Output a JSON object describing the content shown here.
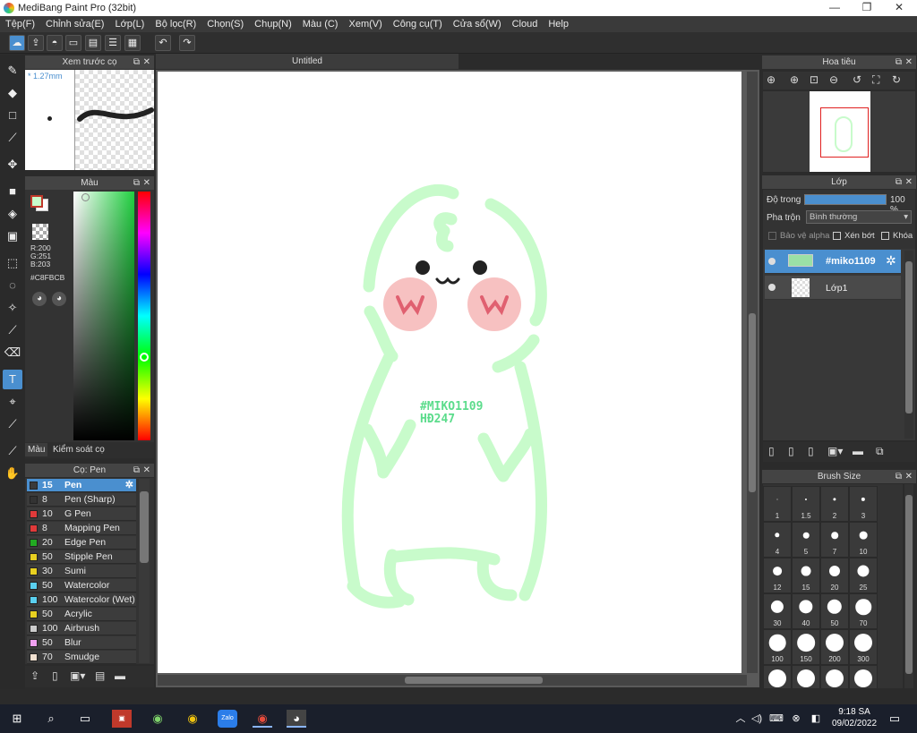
{
  "window": {
    "title": "MediBang Paint Pro (32bit)",
    "minimize": "—",
    "maximize": "❐",
    "close": "✕"
  },
  "menu": [
    "Tệp(F)",
    "Chỉnh sửa(E)",
    "Lớp(L)",
    "Bộ lọc(R)",
    "Chọn(S)",
    "Chụp(N)",
    "Màu (C)",
    "Xem(V)",
    "Công cụ(T)",
    "Cửa sổ(W)",
    "Cloud",
    "Help"
  ],
  "preview_panel": {
    "title": "Xem trước cọ",
    "size": "* 1.27mm"
  },
  "color_panel": {
    "title": "Màu",
    "r": "R:200",
    "g": "G:251",
    "b": "B:203",
    "hex": "#C8FBCB",
    "fg_color": "#C8FBCB",
    "tab_color": "Màu",
    "tab_brush_control": "Kiểm soát cọ"
  },
  "brush_panel": {
    "title": "Cọ: Pen",
    "items": [
      {
        "size": "15",
        "name": "Pen",
        "color": "#3a3a3a"
      },
      {
        "size": "8",
        "name": "Pen (Sharp)",
        "color": "#333333"
      },
      {
        "size": "10",
        "name": "G Pen",
        "color": "#e03a3a"
      },
      {
        "size": "8",
        "name": "Mapping Pen",
        "color": "#e03a3a"
      },
      {
        "size": "20",
        "name": "Edge Pen",
        "color": "#22aa22"
      },
      {
        "size": "50",
        "name": "Stipple Pen",
        "color": "#e8d020"
      },
      {
        "size": "30",
        "name": "Sumi",
        "color": "#e8d020"
      },
      {
        "size": "50",
        "name": "Watercolor",
        "color": "#5ad0f0"
      },
      {
        "size": "100",
        "name": "Watercolor (Wet)",
        "color": "#5ad0f0"
      },
      {
        "size": "50",
        "name": "Acrylic",
        "color": "#e8d020"
      },
      {
        "size": "100",
        "name": "Airbrush",
        "color": "#cccccc"
      },
      {
        "size": "50",
        "name": "Blur",
        "color": "#f0a0f0"
      },
      {
        "size": "70",
        "name": "Smudge",
        "color": "#f0e0d0"
      }
    ]
  },
  "canvas": {
    "tab": "Untitled",
    "drawing_text_1": "#MIKO1109",
    "drawing_text_2": "HĐ247"
  },
  "navigator": {
    "title": "Hoa tiêu"
  },
  "layers_panel": {
    "title": "Lớp",
    "opacity_label": "Độ trong",
    "opacity_value": "100 %",
    "opacity": 1.0,
    "blend_label": "Pha trộn",
    "blend_value": "Bình thường",
    "protect_alpha": "Bảo vệ alpha",
    "clipping": "Xén bớt",
    "lock": "Khóa",
    "layers": [
      {
        "name": "#miko1109",
        "selected": true
      },
      {
        "name": "Lớp1",
        "selected": false
      }
    ]
  },
  "brush_size_panel": {
    "title": "Brush Size",
    "sizes": [
      "1",
      "1.5",
      "2",
      "3",
      "4",
      "5",
      "7",
      "10",
      "12",
      "15",
      "20",
      "25",
      "30",
      "40",
      "50",
      "70",
      "100",
      "150",
      "200",
      "300",
      "",
      "",
      "",
      ""
    ]
  },
  "taskbar": {
    "time": "9:18 SA",
    "date": "09/02/2022",
    "zalo": "Zalo"
  }
}
